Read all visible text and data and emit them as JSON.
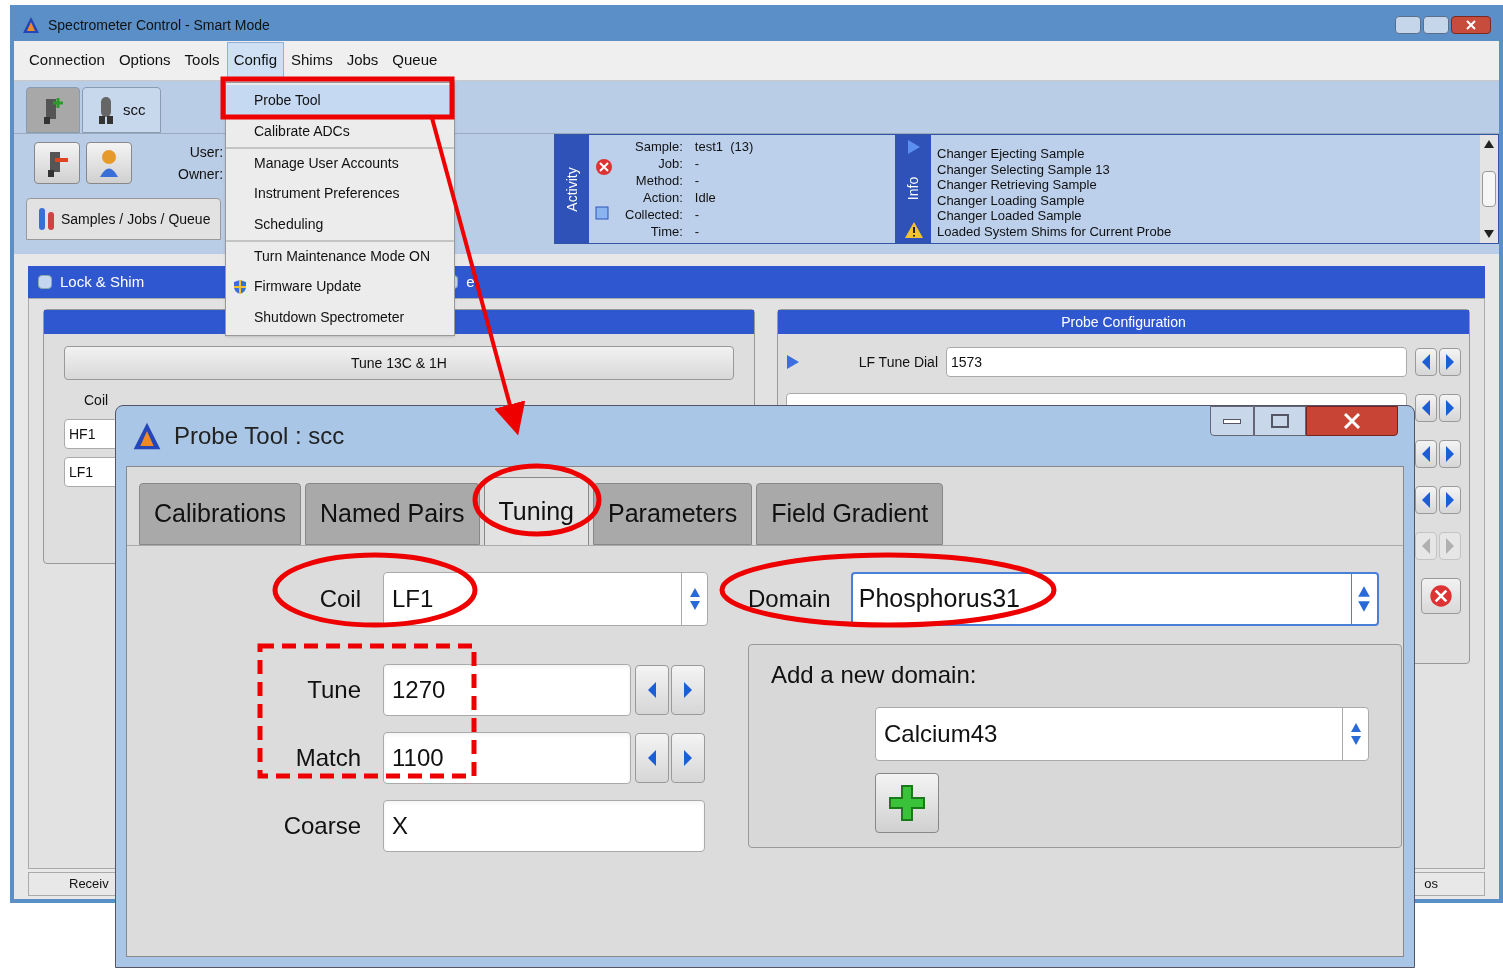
{
  "main_window": {
    "title": "Spectrometer Control - Smart Mode",
    "menu": [
      {
        "label": "Connection",
        "selected": false
      },
      {
        "label": "Options",
        "selected": false
      },
      {
        "label": "Tools",
        "selected": false
      },
      {
        "label": "Config",
        "selected": true
      },
      {
        "label": "Shims",
        "selected": false
      },
      {
        "label": "Jobs",
        "selected": false
      },
      {
        "label": "Queue",
        "selected": false
      }
    ],
    "probe_tabs": [
      {
        "kind": "add",
        "selected": false
      },
      {
        "kind": "probe",
        "label": "scc",
        "selected": true
      }
    ],
    "user_labels": [
      "User:",
      "Owner:"
    ],
    "view_tab": {
      "label": "Samples / Jobs / Queue"
    },
    "activity": {
      "title": "Activity",
      "fields": [
        {
          "label": "Sample:",
          "value": "test1  (13)"
        },
        {
          "label": "Job:",
          "value": "-"
        },
        {
          "label": "Method:",
          "value": "-"
        },
        {
          "label": "Action:",
          "value": "Idle"
        },
        {
          "label": "Collected:",
          "value": "-"
        },
        {
          "label": "Time:",
          "value": "-"
        }
      ]
    },
    "info": {
      "title": "Info",
      "messages": [
        "Changer Ejecting Sample",
        "Changer Selecting Sample 13",
        "Changer Retrieving Sample",
        "Changer Loading Sample",
        "Changer Loaded Sample",
        "Loaded System Shims for Current Probe"
      ]
    },
    "panel_tabs": [
      {
        "label": "Lock & Shim"
      },
      {
        "label": "e"
      }
    ],
    "left_panel": {
      "button": "Tune 13C & 1H",
      "coil_label": "Coil",
      "coils": [
        "HF1",
        "LF1"
      ]
    },
    "probe_configuration": {
      "title": "Probe Configuration",
      "rows": [
        {
          "label": "LF Tune Dial",
          "value": "1573",
          "disabled": false
        },
        {
          "disabled": false
        },
        {
          "disabled": false
        },
        {
          "disabled": false
        },
        {
          "disabled": true
        }
      ]
    },
    "status_bar": [
      "Receiv",
      "os"
    ]
  },
  "config_menu": {
    "items": [
      {
        "label": "Probe Tool",
        "kind": "plain",
        "separator_before": false,
        "selected": true
      },
      {
        "label": "Calibrate ADCs",
        "kind": "plain",
        "separator_before": false,
        "selected": false
      },
      {
        "label": "Manage User Accounts",
        "kind": "plain",
        "separator_before": true,
        "selected": false
      },
      {
        "label": "Instrument Preferences",
        "kind": "plain",
        "separator_before": false,
        "selected": false
      },
      {
        "label": "Scheduling",
        "kind": "plain",
        "separator_before": false,
        "selected": false
      },
      {
        "label": "Turn Maintenance Mode ON",
        "kind": "plain",
        "separator_before": true,
        "selected": false
      },
      {
        "label": "Firmware Update",
        "kind": "shield",
        "separator_before": false,
        "selected": false
      },
      {
        "label": "Shutdown Spectrometer",
        "kind": "plain",
        "separator_before": false,
        "selected": false
      }
    ]
  },
  "probe_tool": {
    "title": "Probe Tool : scc",
    "tabs": [
      {
        "label": "Calibrations",
        "selected": false
      },
      {
        "label": "Named Pairs",
        "selected": false
      },
      {
        "label": "Tuning",
        "selected": true
      },
      {
        "label": "Parameters",
        "selected": false
      },
      {
        "label": "Field Gradient",
        "selected": false
      }
    ],
    "coil": {
      "label": "Coil",
      "value": "LF1"
    },
    "tune": {
      "label": "Tune",
      "value": "1270"
    },
    "match": {
      "label": "Match",
      "value": "1100"
    },
    "coarse": {
      "label": "Coarse",
      "value": "X"
    },
    "domain": {
      "label": "Domain",
      "value": "Phosphorus31"
    },
    "add_domain": {
      "label": "Add a new domain:",
      "value": "Calcium43"
    }
  }
}
